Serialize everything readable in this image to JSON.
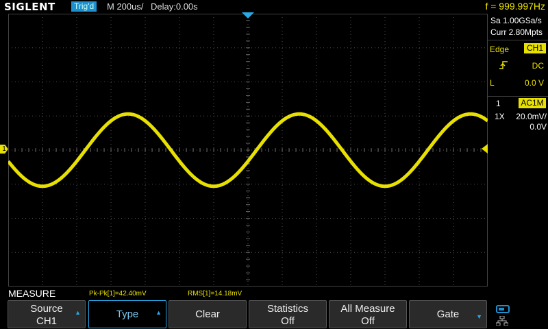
{
  "header": {
    "brand": "SIGLENT",
    "trigger_status": "Trig'd",
    "timebase": "M 200us/",
    "delay": "Delay:0.00s",
    "frequency": "f = 999.997Hz"
  },
  "right_panel": {
    "sample_rate": "Sa 1.00GSa/s",
    "memory_depth": "Curr 2.80Mpts",
    "trigger_type": "Edge",
    "trigger_source": "CH1",
    "trigger_coupling": "DC",
    "level_label": "L",
    "trigger_level": "0.0 V",
    "channel_number": "1",
    "channel_coupling": "AC1M",
    "probe": "1X",
    "volts_per_div": "20.0mV/",
    "offset": "0.0V"
  },
  "markers": {
    "channel_marker": "1"
  },
  "measure": {
    "title": "MEASURE",
    "readouts": [
      "Pk-Pk[1]=42.40mV",
      "RMS[1]=14.18mV"
    ]
  },
  "softkeys": [
    {
      "line1": "Source",
      "line2": "CH1",
      "arrow": "up"
    },
    {
      "line1": "Type",
      "line2": "",
      "arrow": "up",
      "active": true
    },
    {
      "line1": "Clear",
      "line2": ""
    },
    {
      "line1": "Statistics",
      "line2": "Off"
    },
    {
      "line1": "All Measure",
      "line2": "Off"
    },
    {
      "line1": "Gate",
      "line2": "",
      "arrow": "down"
    }
  ],
  "waveform": {
    "color": "#e8e000",
    "frequency_hz": 999.997,
    "volts_per_div_mV": 20,
    "peak_to_peak_mV": 42.4,
    "horizontal_divisions": 14,
    "vertical_divisions": 8
  },
  "colors": {
    "trace": "#e8e000",
    "accent": "#29a9e6",
    "trigger_badge": "#1e90d0"
  }
}
